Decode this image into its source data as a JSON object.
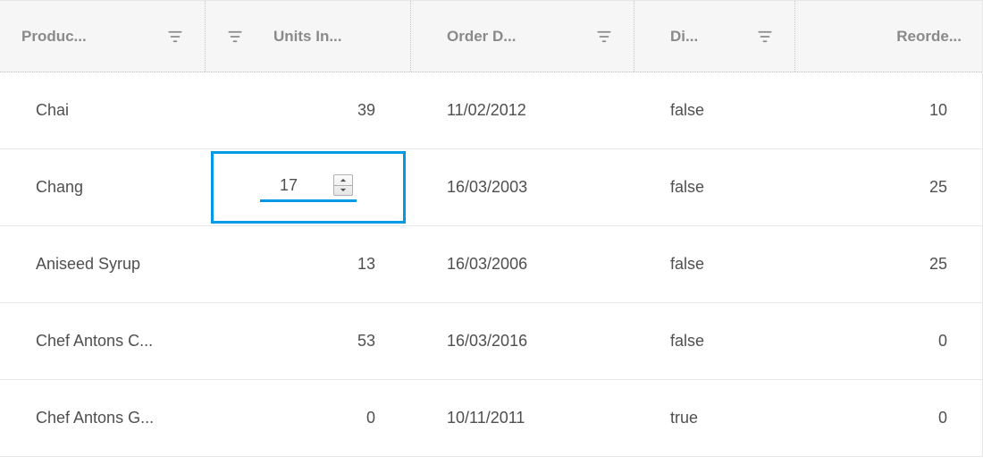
{
  "colors": {
    "accent": "#0099e5",
    "header_bg": "#f6f6f6",
    "border": "#e6e6e6",
    "muted_text": "#8a8a8a"
  },
  "icons": {
    "filter": "filter-icon",
    "spin_up": "chevron-up-icon",
    "spin_down": "chevron-down-icon"
  },
  "grid": {
    "columns": [
      {
        "key": "product",
        "label": "Produc...",
        "has_filter": true,
        "align": "left"
      },
      {
        "key": "unitsInStock",
        "label": "Units In...",
        "has_filter": true,
        "align": "right",
        "filter_position": "left"
      },
      {
        "key": "orderDate",
        "label": "Order D...",
        "has_filter": true,
        "align": "left",
        "filter_position": "right"
      },
      {
        "key": "discontinued",
        "label": "Di...",
        "has_filter": true,
        "align": "left",
        "filter_position": "right"
      },
      {
        "key": "reorder",
        "label": "Reorde...",
        "has_filter": false,
        "align": "right"
      }
    ],
    "rows": [
      {
        "product": "Chai",
        "unitsInStock": "39",
        "orderDate": "11/02/2012",
        "discontinued": "false",
        "reorder": "10"
      },
      {
        "product": "Chang",
        "unitsInStock": "17",
        "orderDate": "16/03/2003",
        "discontinued": "false",
        "reorder": "25",
        "editing_field": "unitsInStock"
      },
      {
        "product": "Aniseed Syrup",
        "unitsInStock": "13",
        "orderDate": "16/03/2006",
        "discontinued": "false",
        "reorder": "25"
      },
      {
        "product": "Chef Antons C...",
        "unitsInStock": "53",
        "orderDate": "16/03/2016",
        "discontinued": "false",
        "reorder": "0"
      },
      {
        "product": "Chef Antons G...",
        "unitsInStock": "0",
        "orderDate": "10/11/2011",
        "discontinued": "true",
        "reorder": "0"
      }
    ]
  }
}
